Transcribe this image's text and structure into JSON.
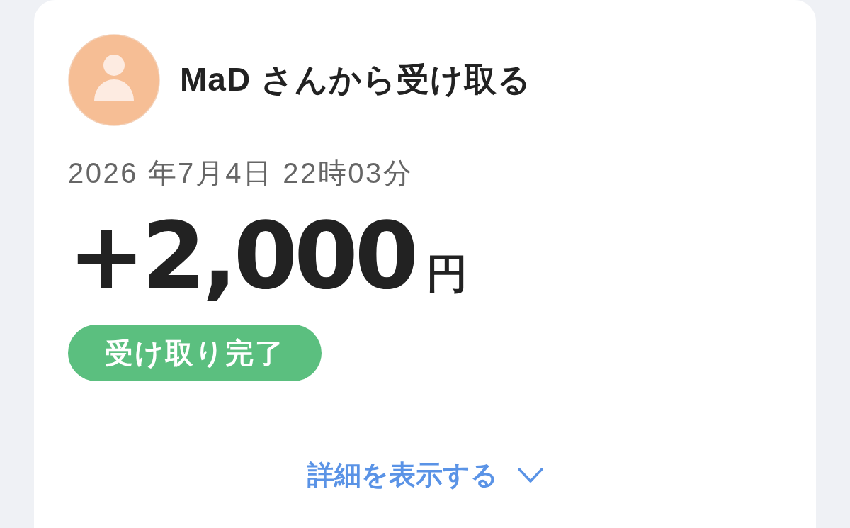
{
  "card": {
    "sender": {
      "title": "MaD さんから受け取る"
    },
    "date": "2026 年7月4日 22時03分",
    "amount": {
      "value": "+2,000",
      "unit": "円"
    },
    "status": {
      "label": "受け取り完了",
      "kind": "complete"
    },
    "details_link": {
      "label": "詳細を表示する",
      "expanded": false
    }
  }
}
